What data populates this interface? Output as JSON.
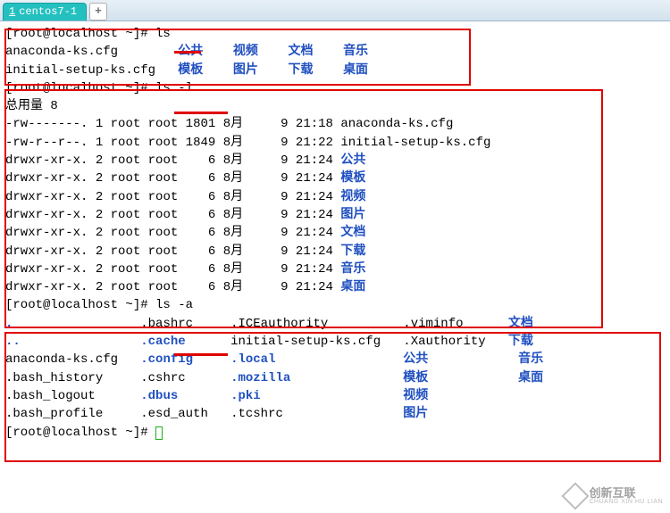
{
  "tab": {
    "index": "1",
    "title": "centos7-1",
    "new_tab_symbol": "+"
  },
  "prompt": "[root@localhost ~]#",
  "cmd1": "ls",
  "ls_output": {
    "row1": [
      {
        "t": "anaconda-ks.cfg",
        "c": "plain",
        "pad": 23
      },
      {
        "t": "公共",
        "c": "dir",
        "pad": 6
      },
      {
        "t": "视频",
        "c": "dir",
        "pad": 6
      },
      {
        "t": "文档",
        "c": "dir",
        "pad": 6
      },
      {
        "t": "音乐",
        "c": "dir",
        "pad": 0
      }
    ],
    "row2": [
      {
        "t": "initial-setup-ks.cfg",
        "c": "plain",
        "pad": 23
      },
      {
        "t": "模板",
        "c": "dir",
        "pad": 6
      },
      {
        "t": "图片",
        "c": "dir",
        "pad": 6
      },
      {
        "t": "下载",
        "c": "dir",
        "pad": 6
      },
      {
        "t": "桌面",
        "c": "dir",
        "pad": 0
      }
    ]
  },
  "cmd2": "ls -l",
  "ls_l_header": "总用量 8",
  "ls_l": [
    {
      "perm": "-rw-------.",
      "n": "1",
      "o": "root",
      "g": "root",
      "sz": "1801",
      "mon": "8月",
      "day": "9",
      "tm": "21:18",
      "name": "anaconda-ks.cfg",
      "c": "plain"
    },
    {
      "perm": "-rw-r--r--.",
      "n": "1",
      "o": "root",
      "g": "root",
      "sz": "1849",
      "mon": "8月",
      "day": "9",
      "tm": "21:22",
      "name": "initial-setup-ks.cfg",
      "c": "plain"
    },
    {
      "perm": "drwxr-xr-x.",
      "n": "2",
      "o": "root",
      "g": "root",
      "sz": "6",
      "mon": "8月",
      "day": "9",
      "tm": "21:24",
      "name": "公共",
      "c": "dir"
    },
    {
      "perm": "drwxr-xr-x.",
      "n": "2",
      "o": "root",
      "g": "root",
      "sz": "6",
      "mon": "8月",
      "day": "9",
      "tm": "21:24",
      "name": "模板",
      "c": "dir"
    },
    {
      "perm": "drwxr-xr-x.",
      "n": "2",
      "o": "root",
      "g": "root",
      "sz": "6",
      "mon": "8月",
      "day": "9",
      "tm": "21:24",
      "name": "视频",
      "c": "dir"
    },
    {
      "perm": "drwxr-xr-x.",
      "n": "2",
      "o": "root",
      "g": "root",
      "sz": "6",
      "mon": "8月",
      "day": "9",
      "tm": "21:24",
      "name": "图片",
      "c": "dir"
    },
    {
      "perm": "drwxr-xr-x.",
      "n": "2",
      "o": "root",
      "g": "root",
      "sz": "6",
      "mon": "8月",
      "day": "9",
      "tm": "21:24",
      "name": "文档",
      "c": "dir"
    },
    {
      "perm": "drwxr-xr-x.",
      "n": "2",
      "o": "root",
      "g": "root",
      "sz": "6",
      "mon": "8月",
      "day": "9",
      "tm": "21:24",
      "name": "下载",
      "c": "dir"
    },
    {
      "perm": "drwxr-xr-x.",
      "n": "2",
      "o": "root",
      "g": "root",
      "sz": "6",
      "mon": "8月",
      "day": "9",
      "tm": "21:24",
      "name": "音乐",
      "c": "dir"
    },
    {
      "perm": "drwxr-xr-x.",
      "n": "2",
      "o": "root",
      "g": "root",
      "sz": "6",
      "mon": "8月",
      "day": "9",
      "tm": "21:24",
      "name": "桌面",
      "c": "dir"
    }
  ],
  "cmd3": "ls -a",
  "ls_a": [
    [
      {
        "t": ".",
        "c": "dir"
      },
      {
        "t": ".bashrc",
        "c": "plain"
      },
      {
        "t": ".ICEauthority",
        "c": "plain"
      },
      {
        "t": ".viminfo",
        "c": "plain"
      },
      {
        "t": "文档",
        "c": "dir"
      }
    ],
    [
      {
        "t": "..",
        "c": "dir"
      },
      {
        "t": ".cache",
        "c": "dir"
      },
      {
        "t": "initial-setup-ks.cfg",
        "c": "plain"
      },
      {
        "t": ".Xauthority",
        "c": "plain"
      },
      {
        "t": "下载",
        "c": "dir"
      }
    ],
    [
      {
        "t": "anaconda-ks.cfg",
        "c": "plain"
      },
      {
        "t": ".config",
        "c": "dir"
      },
      {
        "t": ".local",
        "c": "dir"
      },
      {
        "t": "公共",
        "c": "dir"
      },
      {
        "t": "音乐",
        "c": "dir"
      }
    ],
    [
      {
        "t": ".bash_history",
        "c": "plain"
      },
      {
        "t": ".cshrc",
        "c": "plain"
      },
      {
        "t": ".mozilla",
        "c": "dir"
      },
      {
        "t": "模板",
        "c": "dir"
      },
      {
        "t": "桌面",
        "c": "dir"
      }
    ],
    [
      {
        "t": ".bash_logout",
        "c": "plain"
      },
      {
        "t": ".dbus",
        "c": "dir"
      },
      {
        "t": ".pki",
        "c": "dir"
      },
      {
        "t": "视频",
        "c": "dir"
      },
      {
        "t": "",
        "c": "plain"
      }
    ],
    [
      {
        "t": ".bash_profile",
        "c": "plain"
      },
      {
        "t": ".esd_auth",
        "c": "plain"
      },
      {
        "t": ".tcshrc",
        "c": "plain"
      },
      {
        "t": "图片",
        "c": "dir"
      },
      {
        "t": "",
        "c": "plain"
      }
    ]
  ],
  "watermark": {
    "cn": "创新互联",
    "py": "CHUANG XIN HU LIAN"
  }
}
